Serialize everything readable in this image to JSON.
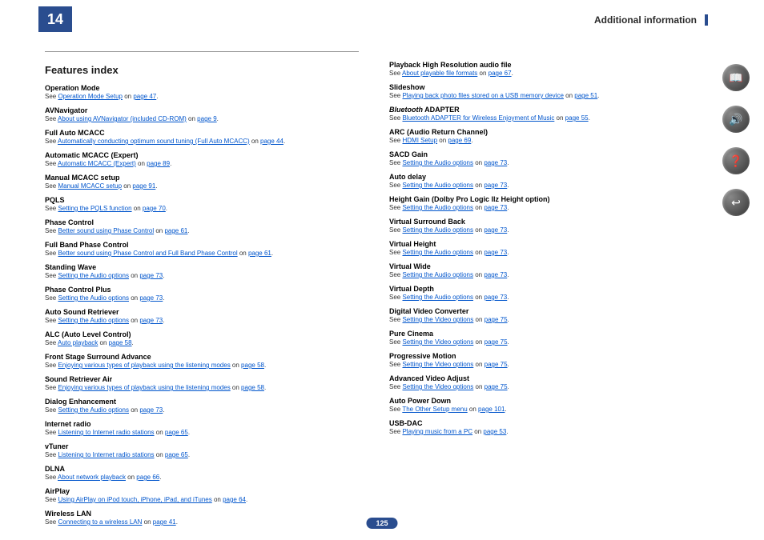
{
  "header": {
    "chapter": "14",
    "title": "Additional information",
    "page": "125"
  },
  "section_title": "Features index",
  "col1": [
    {
      "title": "Operation Mode",
      "pre": "See ",
      "link": "Operation Mode Setup",
      "mid": " on ",
      "page": "page 47",
      "post": "."
    },
    {
      "title": "AVNavigator",
      "pre": "See ",
      "link": "About using AVNavigator (included CD-ROM)",
      "mid": " on ",
      "page": "page 9",
      "post": "."
    },
    {
      "title": "Full Auto MCACC",
      "pre": "See ",
      "link": "Automatically conducting optimum sound tuning (Full Auto MCACC)",
      "mid": " on ",
      "page": "page 44",
      "post": "."
    },
    {
      "title": "Automatic MCACC (Expert)",
      "pre": "See ",
      "link": "Automatic MCACC (Expert)",
      "mid": " on ",
      "page": "page 89",
      "post": "."
    },
    {
      "title": "Manual MCACC setup",
      "pre": "See ",
      "link": "Manual MCACC setup",
      "mid": " on ",
      "page": "page 91",
      "post": "."
    },
    {
      "title": "PQLS",
      "pre": "See ",
      "link": "Setting the PQLS function",
      "mid": " on ",
      "page": "page 70",
      "post": "."
    },
    {
      "title": "Phase Control",
      "pre": "See ",
      "link": "Better sound using Phase Control",
      "mid": " on ",
      "page": "page 61",
      "post": "."
    },
    {
      "title": "Full Band Phase Control",
      "pre": "See ",
      "link": "Better sound using Phase Control and Full Band Phase Control",
      "mid": " on ",
      "page": "page 61",
      "post": "."
    },
    {
      "title": "Standing Wave",
      "pre": "See ",
      "link": "Setting the Audio options",
      "mid": " on ",
      "page": "page 73",
      "post": "."
    },
    {
      "title": "Phase Control Plus",
      "pre": "See ",
      "link": "Setting the Audio options",
      "mid": " on ",
      "page": "page 73",
      "post": "."
    },
    {
      "title": "Auto Sound Retriever",
      "pre": "See ",
      "link": "Setting the Audio options",
      "mid": " on ",
      "page": "page 73",
      "post": "."
    },
    {
      "title": "ALC (Auto Level Control)",
      "pre": "See ",
      "link": "Auto playback",
      "mid": " on ",
      "page": "page 58",
      "post": "."
    },
    {
      "title": "Front Stage Surround Advance",
      "pre": "See ",
      "link": "Enjoying various types of playback using the listening modes",
      "mid": " on ",
      "page": "page 58",
      "post": "."
    },
    {
      "title": "Sound Retriever Air",
      "pre": "See ",
      "link": "Enjoying various types of playback using the listening modes",
      "mid": " on ",
      "page": "page 58",
      "post": "."
    },
    {
      "title": "Dialog Enhancement",
      "pre": "See ",
      "link": "Setting the Audio options",
      "mid": " on ",
      "page": "page 73",
      "post": "."
    },
    {
      "title": "Internet radio",
      "pre": "See ",
      "link": "Listening to Internet radio stations",
      "mid": " on ",
      "page": "page 65",
      "post": "."
    },
    {
      "title": "vTuner",
      "pre": "See ",
      "link": "Listening to Internet radio stations",
      "mid": " on ",
      "page": "page 65",
      "post": "."
    },
    {
      "title": "DLNA",
      "pre": "See ",
      "link": "About network playback",
      "mid": " on ",
      "page": "page 66",
      "post": "."
    },
    {
      "title": "AirPlay",
      "pre": "See ",
      "link": "Using AirPlay on iPod touch, iPhone, iPad, and iTunes",
      "mid": " on ",
      "page": "page 64",
      "post": "."
    },
    {
      "title": "Wireless LAN",
      "pre": "See ",
      "link": "Connecting to a wireless LAN",
      "mid": " on ",
      "page": "page 41",
      "post": "."
    }
  ],
  "col2": [
    {
      "title": "Playback High Resolution audio file",
      "pre": "See ",
      "link": "About playable file formats",
      "mid": " on ",
      "page": "page 67",
      "post": "."
    },
    {
      "title": "Slideshow",
      "pre": "See ",
      "link": "Playing back photo files stored on a USB memory device",
      "mid": " on ",
      "page": "page 51",
      "post": "."
    },
    {
      "title_html": "<span class='italic'>Bluetooth</span> ADAPTER",
      "pre": "See ",
      "link": "Bluetooth ADAPTER for Wireless Enjoyment of Music",
      "mid": " on ",
      "page": "page 55",
      "post": "."
    },
    {
      "title": "ARC (Audio Return Channel)",
      "pre": "See ",
      "link": "HDMI Setup",
      "mid": " on ",
      "page": "page 69",
      "post": "."
    },
    {
      "title": "SACD Gain",
      "pre": "See ",
      "link": "Setting the Audio options",
      "mid": " on ",
      "page": "page 73",
      "post": "."
    },
    {
      "title": "Auto delay",
      "pre": "See ",
      "link": "Setting the Audio options",
      "mid": " on ",
      "page": "page 73",
      "post": "."
    },
    {
      "title": "Height Gain (Dolby Pro Logic llz Height option)",
      "pre": "See ",
      "link": "Setting the Audio options",
      "mid": " on ",
      "page": "page 73",
      "post": "."
    },
    {
      "title": "Virtual Surround Back",
      "pre": "See ",
      "link": "Setting the Audio options",
      "mid": " on ",
      "page": "page 73",
      "post": "."
    },
    {
      "title": "Virtual Height",
      "pre": "See ",
      "link": "Setting the Audio options",
      "mid": " on ",
      "page": "page 73",
      "post": "."
    },
    {
      "title": "Virtual Wide",
      "pre": "See ",
      "link": "Setting the Audio options",
      "mid": " on ",
      "page": "page 73",
      "post": "."
    },
    {
      "title": "Virtual Depth",
      "pre": "See ",
      "link": "Setting the Audio options",
      "mid": " on ",
      "page": "page 73",
      "post": "."
    },
    {
      "title": "Digital Video Converter",
      "pre": "See ",
      "link": "Setting the Video options",
      "mid": " on ",
      "page": "page 75",
      "post": "."
    },
    {
      "title": "Pure Cinema",
      "pre": "See ",
      "link": "Setting the Video options",
      "mid": " on ",
      "page": "page 75",
      "post": "."
    },
    {
      "title": "Progressive Motion",
      "pre": "See ",
      "link": "Setting the Video options",
      "mid": " on ",
      "page": "page 75",
      "post": "."
    },
    {
      "title": "Advanced Video Adjust",
      "pre": "See ",
      "link": "Setting the Video options",
      "mid": " on ",
      "page": "page 75",
      "post": "."
    },
    {
      "title": "Auto Power Down",
      "pre": "See ",
      "link": "The Other Setup menu",
      "mid": " on ",
      "page": "page 101",
      "post": "."
    },
    {
      "title": "USB-DAC",
      "pre": "See ",
      "link": "Playing music from a PC",
      "mid": " on ",
      "page": "page 53",
      "post": "."
    }
  ],
  "icons": [
    "📖",
    "🔊",
    "❓",
    "↩"
  ]
}
